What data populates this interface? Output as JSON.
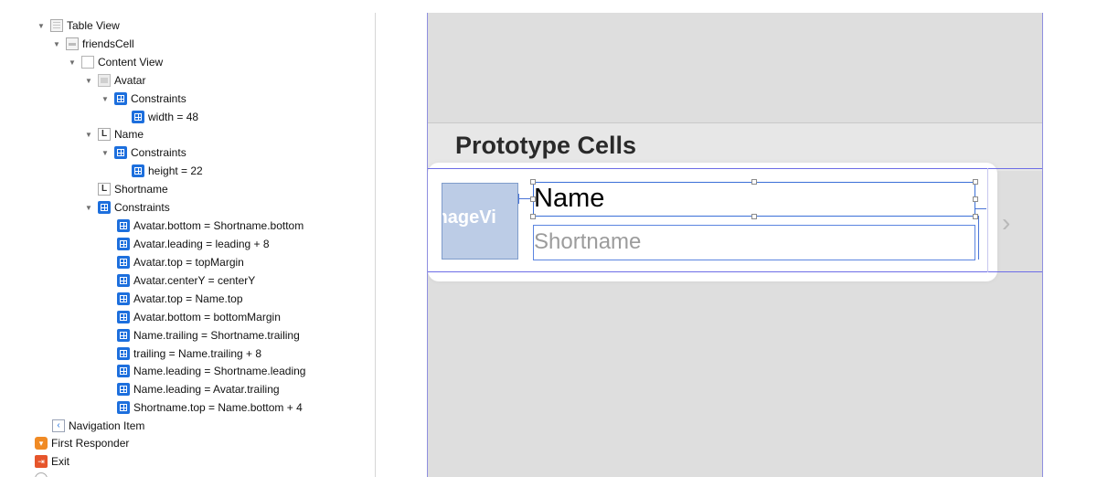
{
  "outline": {
    "items": [
      {
        "label": "Table View",
        "icon": "tableview"
      },
      {
        "label": "friendsCell",
        "icon": "cell"
      },
      {
        "label": "Content View",
        "icon": "contentview"
      },
      {
        "label": "Avatar",
        "icon": "imageview"
      },
      {
        "label": "Constraints",
        "icon": "constraint"
      },
      {
        "label": "width = 48",
        "icon": "constraint"
      },
      {
        "label": "Name",
        "icon": "label"
      },
      {
        "label": "Constraints",
        "icon": "constraint"
      },
      {
        "label": "height = 22",
        "icon": "constraint"
      },
      {
        "label": "Shortname",
        "icon": "label"
      },
      {
        "label": "Constraints",
        "icon": "constraint"
      },
      {
        "label": "Avatar.bottom = Shortname.bottom",
        "icon": "constraint"
      },
      {
        "label": "Avatar.leading = leading + 8",
        "icon": "constraint"
      },
      {
        "label": "Avatar.top = topMargin",
        "icon": "constraint"
      },
      {
        "label": "Avatar.centerY = centerY",
        "icon": "constraint"
      },
      {
        "label": "Avatar.top = Name.top",
        "icon": "constraint"
      },
      {
        "label": "Avatar.bottom = bottomMargin",
        "icon": "constraint"
      },
      {
        "label": "Name.trailing = Shortname.trailing",
        "icon": "constraint"
      },
      {
        "label": "trailing = Name.trailing + 8",
        "icon": "constraint"
      },
      {
        "label": "Name.leading = Shortname.leading",
        "icon": "constraint"
      },
      {
        "label": "Name.leading = Avatar.trailing",
        "icon": "constraint"
      },
      {
        "label": "Shortname.top = Name.bottom + 4",
        "icon": "constraint"
      },
      {
        "label": "Navigation Item",
        "icon": "navitem"
      },
      {
        "label": "First Responder",
        "icon": "responder"
      },
      {
        "label": "Exit",
        "icon": "exit"
      }
    ]
  },
  "canvas": {
    "section_title": "Prototype Cells",
    "avatar_label": "mageVi",
    "name_label": "Name",
    "shortname_label": "Shortname",
    "chevron": "›"
  },
  "colors": {
    "accent": "#1d6fdd",
    "selection": "#3a6fd8",
    "canvas_bg": "#dedede"
  }
}
